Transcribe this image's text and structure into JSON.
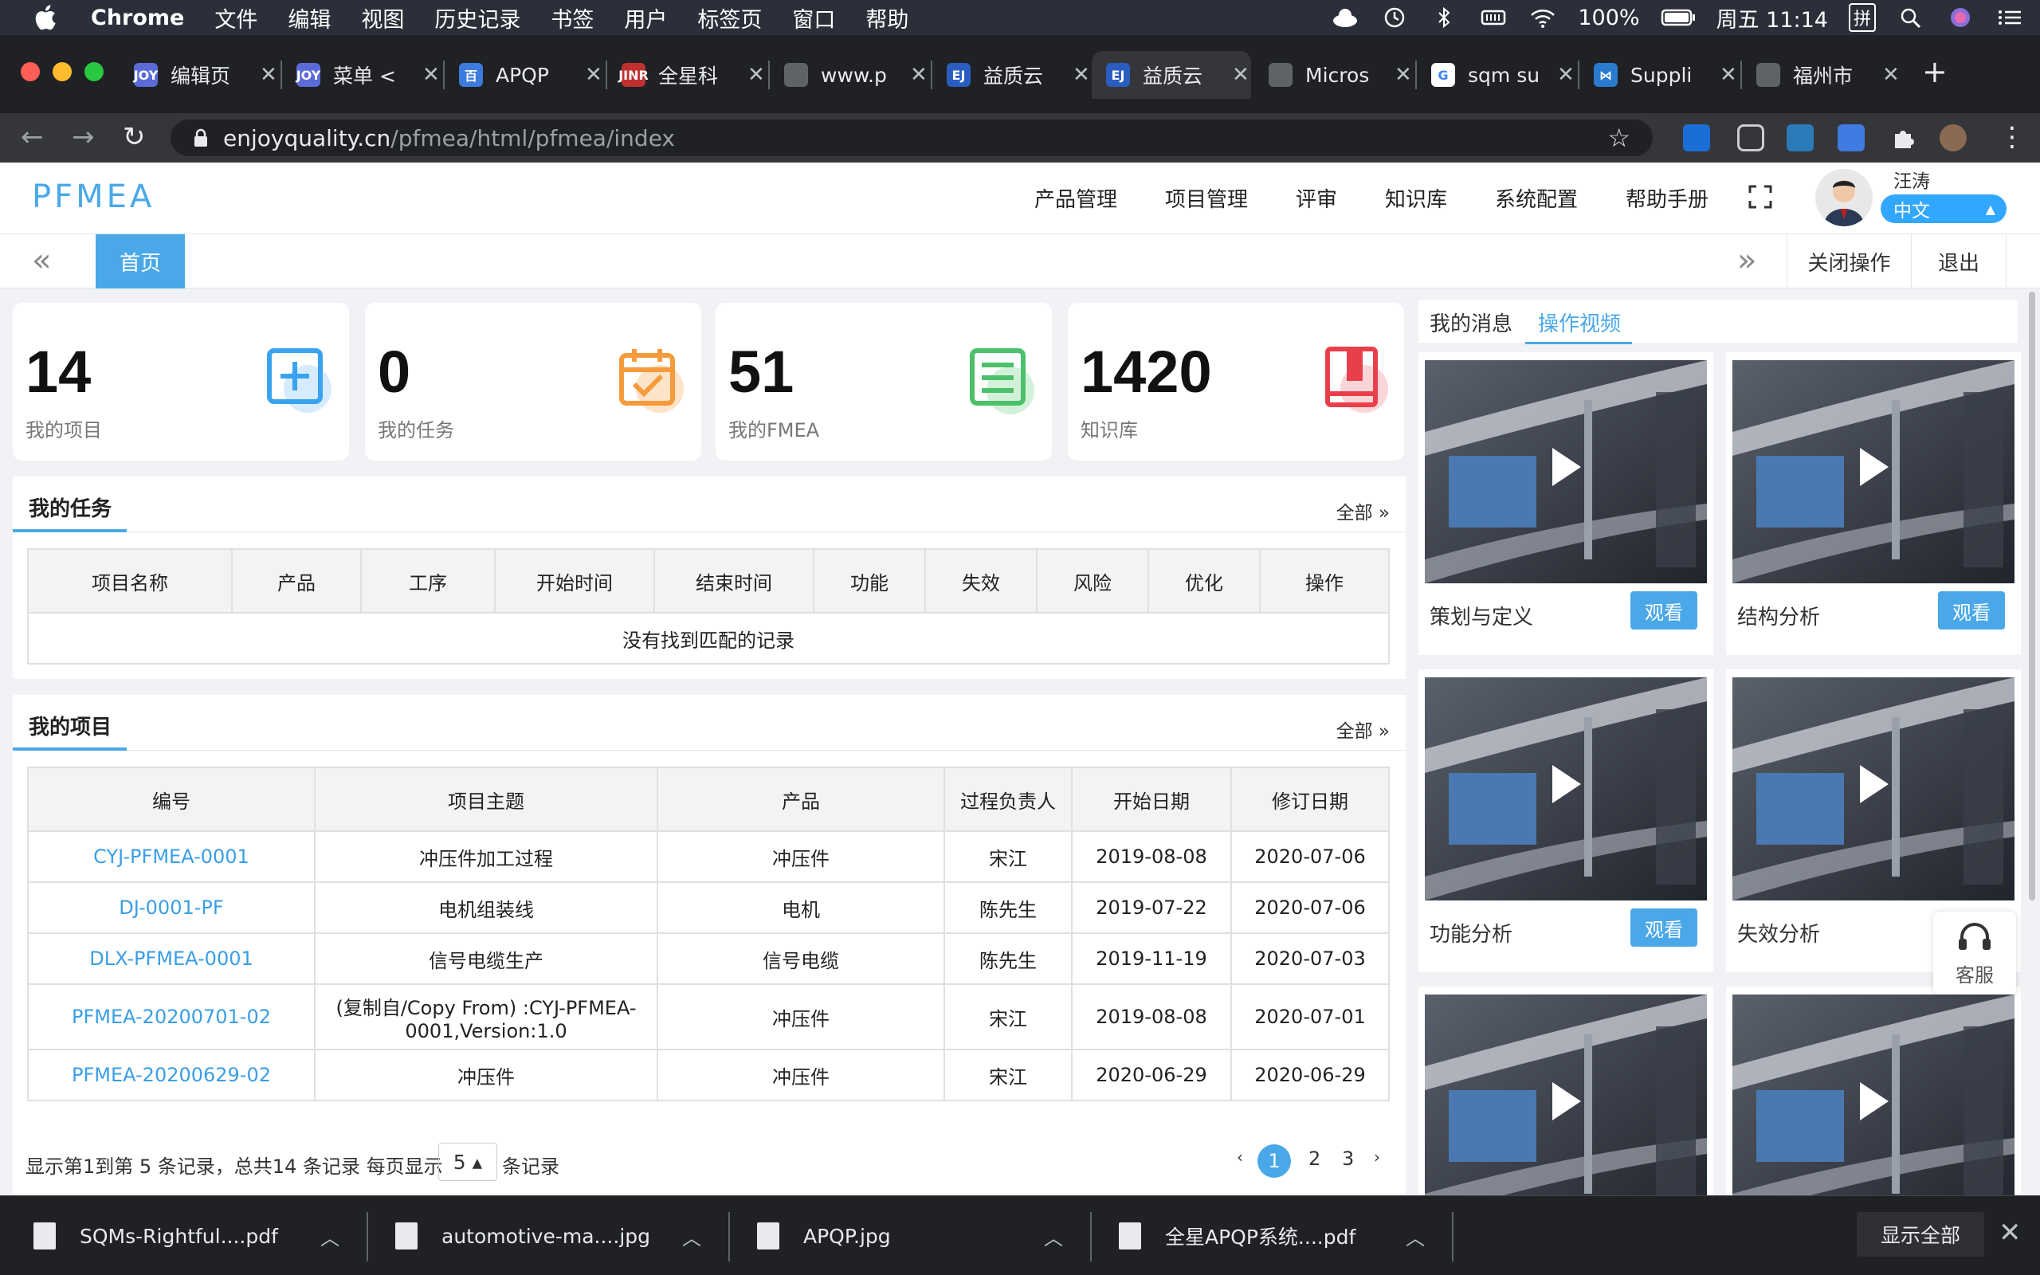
{
  "menubar": {
    "app": "Chrome",
    "items": [
      "文件",
      "编辑",
      "视图",
      "历史记录",
      "书签",
      "用户",
      "标签页",
      "窗口",
      "帮助"
    ],
    "battery": "100%",
    "clock": "周五 11:14",
    "input_method": "拼"
  },
  "tabs": [
    {
      "title": "编辑页",
      "fav_color": "#5b6bd8",
      "fav": "JOY"
    },
    {
      "title": "菜单 <",
      "fav_color": "#5b6bd8",
      "fav": "JOY"
    },
    {
      "title": "APQP",
      "fav_color": "#3d7bdc",
      "fav": "百"
    },
    {
      "title": "全星科",
      "fav_color": "#c03030",
      "fav": "JINR"
    },
    {
      "title": "www.p",
      "fav_color": "#5f6368",
      "fav": ""
    },
    {
      "title": "益质云",
      "fav_color": "#2a5dbf",
      "fav": "EJ"
    },
    {
      "title": "益质云",
      "fav_color": "#2a5dbf",
      "fav": "EJ",
      "active": true
    },
    {
      "title": "Micros",
      "fav_color": "#5f6368",
      "fav": ""
    },
    {
      "title": "sqm su",
      "fav_color": "#ffffff",
      "fav": "G"
    },
    {
      "title": "Suppli",
      "fav_color": "#2a7ad0",
      "fav": "⋈"
    },
    {
      "title": "福州市",
      "fav_color": "#5f6368",
      "fav": ""
    }
  ],
  "address": {
    "host": "enjoyquality.cn",
    "path": "/pfmea/html/pfmea/index"
  },
  "app": {
    "logo": "PFMEA",
    "nav": [
      "产品管理",
      "项目管理",
      "评审",
      "知识库",
      "系统配置",
      "帮助手册"
    ],
    "username": "汪涛",
    "language": "中文"
  },
  "page_tabs": {
    "home": "首页",
    "close_ops": "关闭操作",
    "logout": "退出"
  },
  "stats": [
    {
      "value": "14",
      "label": "我的项目",
      "color": "#3aa3f0",
      "icon": "plus-square-icon"
    },
    {
      "value": "0",
      "label": "我的任务",
      "color": "#f59b3c",
      "icon": "calendar-check-icon"
    },
    {
      "value": "51",
      "label": "我的FMEA",
      "color": "#4cc06a",
      "icon": "list-icon"
    },
    {
      "value": "1420",
      "label": "知识库",
      "color": "#e8404a",
      "icon": "book-icon"
    }
  ],
  "tasks": {
    "title": "我的任务",
    "all": "全部 »",
    "columns": [
      "项目名称",
      "产品",
      "工序",
      "开始时间",
      "结束时间",
      "功能",
      "失效",
      "风险",
      "优化",
      "操作"
    ],
    "empty": "没有找到匹配的记录"
  },
  "projects": {
    "title": "我的项目",
    "all": "全部 »",
    "columns": [
      "编号",
      "项目主题",
      "产品",
      "过程负责人",
      "开始日期",
      "修订日期"
    ],
    "rows": [
      [
        "CYJ-PFMEA-0001",
        "冲压件加工过程",
        "冲压件",
        "宋江",
        "2019-08-08",
        "2020-07-06"
      ],
      [
        "DJ-0001-PF",
        "电机组装线",
        "电机",
        "陈先生",
        "2019-07-22",
        "2020-07-06"
      ],
      [
        "DLX-PFMEA-0001",
        "信号电缆生产",
        "信号电缆",
        "陈先生",
        "2019-11-19",
        "2020-07-03"
      ],
      [
        "PFMEA-20200701-02",
        "(复制自/Copy From) :CYJ-PFMEA-0001,Version:1.0",
        "冲压件",
        "宋江",
        "2019-08-08",
        "2020-07-01"
      ],
      [
        "PFMEA-20200629-02",
        "冲压件",
        "冲压件",
        "宋江",
        "2020-06-29",
        "2020-06-29"
      ]
    ]
  },
  "pager": {
    "info_pre": "显示第1到第 5 条记录，总共14 条记录  每页显示",
    "size": "5 ▴",
    "info_post": "条记录",
    "prev": "‹",
    "pages": [
      "1",
      "2",
      "3"
    ],
    "next": "›"
  },
  "right": {
    "tabs": [
      "我的消息",
      "操作视频"
    ],
    "videos": [
      {
        "caption": "策划与定义",
        "button": "观看"
      },
      {
        "caption": "结构分析",
        "button": "观看"
      },
      {
        "caption": "功能分析",
        "button": "观看"
      },
      {
        "caption": "失效分析",
        "button": ""
      },
      {
        "caption": "",
        "button": ""
      },
      {
        "caption": "",
        "button": ""
      }
    ],
    "support": "客服"
  },
  "downloads": {
    "files": [
      "SQMs-Rightful....pdf",
      "automotive-ma....jpg",
      "APQP.jpg",
      "全星APQP系统....pdf"
    ],
    "show_all": "显示全部"
  }
}
